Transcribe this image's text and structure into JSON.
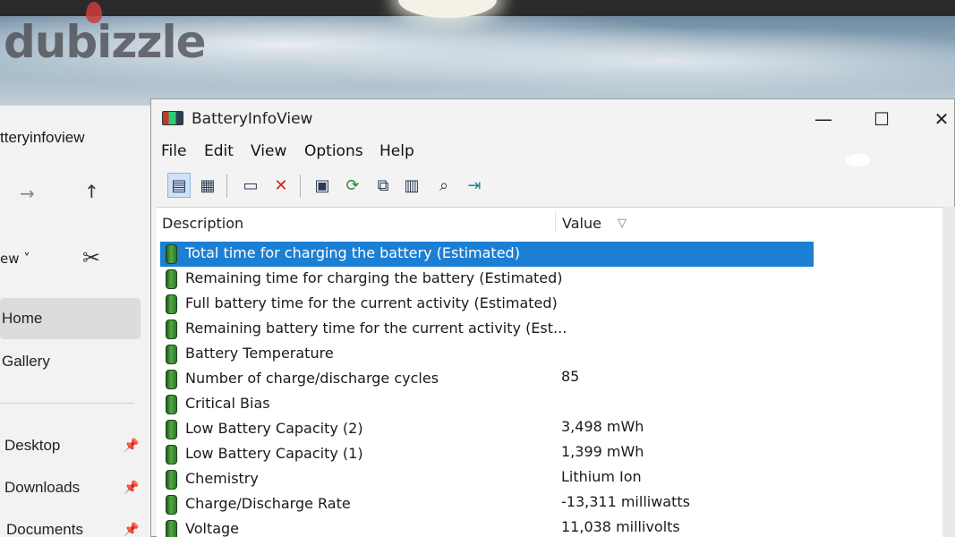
{
  "watermark": {
    "text": "dubizzle"
  },
  "explorer": {
    "title": "tteryinfoview",
    "view_label": "ew ˅",
    "nav_items": [
      {
        "label": "Home"
      },
      {
        "label": "Gallery"
      },
      {
        "label": "Desktop"
      },
      {
        "label": "Downloads"
      },
      {
        "label": "Documents"
      }
    ],
    "icons": {
      "back": "arrow-right-icon",
      "up": "arrow-up-icon",
      "cut": "scissors-icon",
      "pin": "pin-icon"
    }
  },
  "app": {
    "title": "BatteryInfoView",
    "menu": [
      "File",
      "Edit",
      "View",
      "Options",
      "Help"
    ],
    "window_controls": {
      "minimize": "—",
      "maximize": "☐",
      "close": "✕"
    },
    "toolbar_icons": [
      "properties-icon",
      "report-icon",
      "window-icon",
      "delete-icon",
      "save-icon",
      "refresh-icon",
      "copy-icon",
      "html-report-icon",
      "find-icon",
      "exit-icon"
    ],
    "columns": {
      "description": "Description",
      "value": "Value"
    },
    "selected_color": "#1b7fd4",
    "rows": [
      {
        "description": "Total  time for charging the battery (Estimated)",
        "value": ""
      },
      {
        "description": "Remaining time for charging the battery (Estimated)",
        "value": ""
      },
      {
        "description": "Full battery time for the current activity (Estimated)",
        "value": ""
      },
      {
        "description": "Remaining battery time for the current activity (Est...",
        "value": ""
      },
      {
        "description": "Battery Temperature",
        "value": ""
      },
      {
        "description": "Number of charge/discharge cycles",
        "value": "85"
      },
      {
        "description": "Critical Bias",
        "value": ""
      },
      {
        "description": "Low Battery Capacity (2)",
        "value": "3,498 mWh"
      },
      {
        "description": "Low Battery Capacity (1)",
        "value": "1,399 mWh"
      },
      {
        "description": "Chemistry",
        "value": "Lithium Ion"
      },
      {
        "description": "Charge/Discharge Rate",
        "value": "-13,311 milliwatts"
      },
      {
        "description": "Voltage",
        "value": "11,038 millivolts"
      }
    ]
  }
}
